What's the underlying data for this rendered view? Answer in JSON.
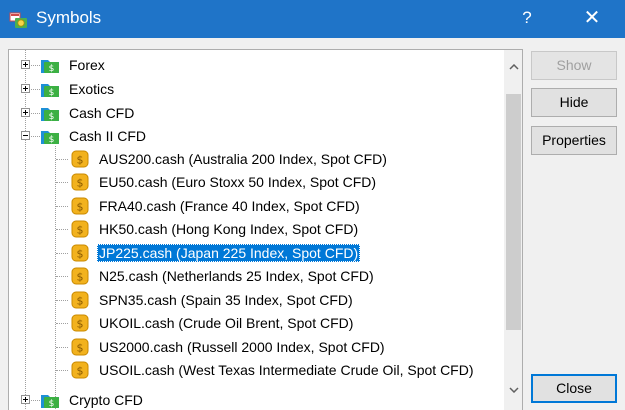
{
  "window": {
    "title": "Symbols",
    "help_glyph": "?",
    "close_glyph": "✕"
  },
  "tree": {
    "groups": [
      {
        "label": "Forex",
        "expanded": false
      },
      {
        "label": "Exotics",
        "expanded": false
      },
      {
        "label": "Cash CFD",
        "expanded": false
      },
      {
        "label": "Cash II CFD",
        "expanded": true
      },
      {
        "label": "Crypto CFD",
        "expanded": false
      }
    ],
    "symbols": [
      {
        "label": "AUS200.cash  (Australia 200 Index, Spot CFD)"
      },
      {
        "label": "EU50.cash  (Euro Stoxx 50 Index, Spot CFD)"
      },
      {
        "label": "FRA40.cash  (France 40 Index, Spot CFD)"
      },
      {
        "label": "HK50.cash  (Hong Kong Index, Spot CFD)"
      },
      {
        "label": "JP225.cash  (Japan 225 Index, Spot CFD)",
        "selected": true
      },
      {
        "label": "N25.cash  (Netherlands 25 Index, Spot CFD)"
      },
      {
        "label": "SPN35.cash  (Spain 35 Index, Spot CFD)"
      },
      {
        "label": "UKOIL.cash  (Crude Oil Brent, Spot CFD)"
      },
      {
        "label": "US2000.cash  (Russell 2000 Index, Spot CFD)"
      },
      {
        "label": "USOIL.cash  (West Texas Intermediate Crude Oil, Spot CFD)"
      }
    ]
  },
  "buttons": {
    "show": "Show",
    "hide": "Hide",
    "properties": "Properties",
    "close": "Close"
  },
  "colors": {
    "titlebar": "#1f74c8",
    "selection": "#0078d7",
    "folder_green": "#3cb043",
    "folder_blue": "#1e90d6",
    "coin_gold": "#f2b21e"
  }
}
